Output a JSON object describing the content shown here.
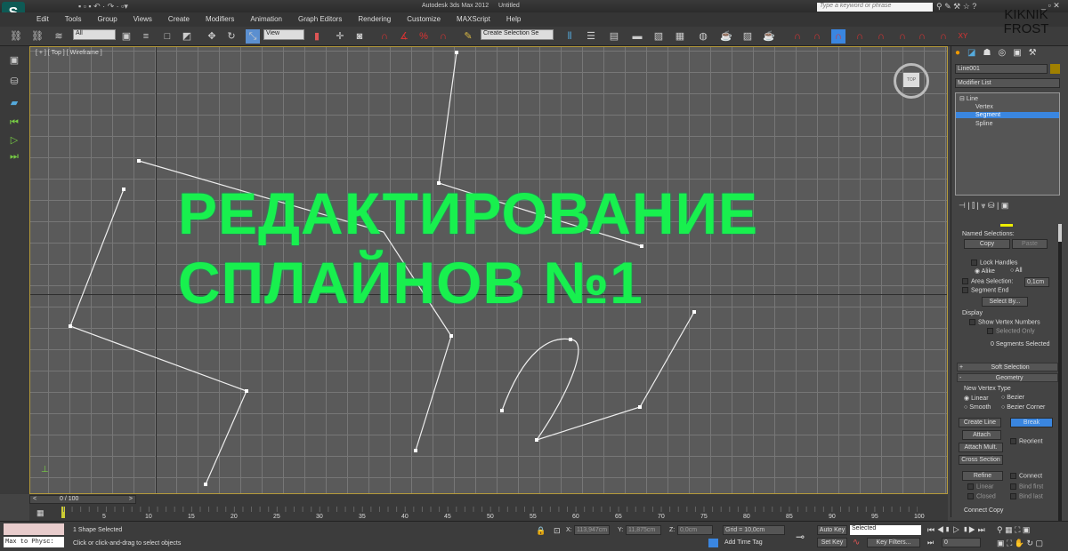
{
  "app": {
    "title": "Autodesk 3ds Max  2012",
    "document": "Untitled",
    "search_placeholder": "Type a keyword or phrase",
    "watermark": "KIKNIK FROST",
    "logo": "S"
  },
  "menu": [
    "Edit",
    "Tools",
    "Group",
    "Views",
    "Create",
    "Modifiers",
    "Animation",
    "Graph Editors",
    "Rendering",
    "Customize",
    "MAXScript",
    "Help"
  ],
  "toolbar": {
    "filter": "All",
    "ref_coord": "View",
    "named_selection": "Create Selection Se",
    "snap_3": "3",
    "snap_pct": "%"
  },
  "viewport": {
    "label": "[ + ] [ Top ] [ Wireframe ]",
    "viewcube": "TOP",
    "overlay_line1": "РЕДАКТИРОВАНИЕ",
    "overlay_line2": "СПЛАЙНОВ №1"
  },
  "command_panel": {
    "object_name": "Line001",
    "object_color": "#a08000",
    "modifier_list": "Modifier List",
    "stack": [
      {
        "label": "Line"
      },
      {
        "label": "Vertex"
      },
      {
        "label": "Segment",
        "selected": true
      },
      {
        "label": "Spline"
      }
    ],
    "named_selections": "Named Selections:",
    "copy": "Copy",
    "paste": "Paste",
    "lock_handles": "Lock Handles",
    "alike": "Alike",
    "all": "All",
    "area_selection": "Area Selection:",
    "area_value": "0,1cm",
    "segment_end": "Segment End",
    "select_by": "Select By...",
    "display": "Display",
    "show_vertex_numbers": "Show Vertex Numbers",
    "selected_only": "Selected Only",
    "segments_selected": "0 Segments Selected",
    "soft_selection": "Soft Selection",
    "geometry": "Geometry",
    "new_vertex_type": "New Vertex Type",
    "linear": "Linear",
    "bezier": "Bezier",
    "smooth": "Smooth",
    "bezier_corner": "Bezier Corner",
    "create_line": "Create Line",
    "break": "Break",
    "attach": "Attach",
    "reorient": "Reorient",
    "attach_mult": "Attach Mult.",
    "cross_section": "Cross Section",
    "refine": "Refine",
    "connect": "Connect",
    "linear2": "Linear",
    "bind_first": "Bind first",
    "closed": "Closed",
    "bind_last": "Bind last",
    "connect_copy": "Connect Copy"
  },
  "timeline": {
    "frame": "0 / 100",
    "prev": "<",
    "next": ">",
    "ticks": [
      "5",
      "10",
      "15",
      "20",
      "25",
      "30",
      "35",
      "40",
      "45",
      "50",
      "55",
      "60",
      "65",
      "70",
      "75",
      "80",
      "85",
      "90",
      "95",
      "100"
    ]
  },
  "status": {
    "script_label": "Max to Physc:",
    "selection": "1 Shape Selected",
    "prompt": "Click or click-and-drag to select objects",
    "x_label": "X:",
    "x": "113,947cm",
    "y_label": "Y:",
    "y": "11,875cm",
    "z_label": "Z:",
    "z": "0,0cm",
    "grid": "Grid = 10,0cm",
    "add_time_tag": "Add Time Tag",
    "auto_key": "Auto Key",
    "set_key": "Set Key",
    "key_mode": "Selected",
    "key_filters": "Key Filters...",
    "current_frame": "0"
  },
  "colors": {
    "accent": "#3a86e0",
    "overlay": "#18f04e"
  }
}
